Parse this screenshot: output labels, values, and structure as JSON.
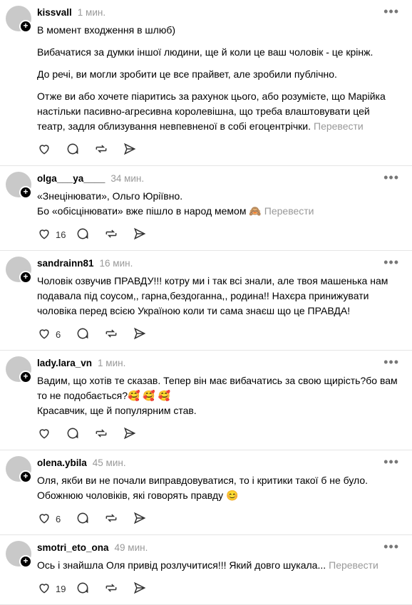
{
  "posts": [
    {
      "user": "kissvall",
      "time": "1 мин.",
      "paragraphs": [
        "В момент входження в шлюб)",
        "Вибачатися за думки іншої людини, ще й коли це ваш чоловік - це крінж.",
        "До речі, ви могли зробити це все прайвет, але зробили публічно.",
        "Отже ви або хочете піаритись за рахунок цього, або розумієте, що Марійка настільки пасивно-агресивна королевішна, що треба влаштовувати цей театр, задля облизування невпевненої в собі егоцентрічки."
      ],
      "translate": "Перевести",
      "likes": ""
    },
    {
      "user": "olga___ya____",
      "time": "34 мин.",
      "paragraphs": [
        "«Знецінювати», Ольго Юріївно.\nБо «обісцінювати» вже пішло в народ мемом 🙈"
      ],
      "translate": "Перевести",
      "likes": "16"
    },
    {
      "user": "sandrainn81",
      "time": "16 мин.",
      "paragraphs": [
        "Чоловік озвучив ПРАВДУ!!! котру ми і так всі знали, але твоя машенька нам подавала під соусом,, гарна,бездоганна,, родина!! Нахєра принижувати чоловіка перед всією Україною коли ти сама знаєш що це ПРАВДА!"
      ],
      "translate": "",
      "likes": "6"
    },
    {
      "user": "lady.lara_vn",
      "time": "1 мин.",
      "paragraphs": [
        "Вадим, що хотів те сказав. Тепер він має вибачатись за свою щирість?бо вам то не подобається?🥰 🥰 🥰\nКрасавчик, ще й популярним став."
      ],
      "translate": "",
      "likes": ""
    },
    {
      "user": "olena.ybila",
      "time": "45 мин.",
      "paragraphs": [
        "Оля, якби ви не почали виправдовуватися, то і критики такої б не було. Обожнюю чоловіків, які говорять правду 😊"
      ],
      "translate": "",
      "likes": "6"
    },
    {
      "user": "smotri_eto_ona",
      "time": "49 мин.",
      "paragraphs": [
        "Ось і знайшла Оля привід розлучитися!!! Який довго шукала..."
      ],
      "translate": "Перевести",
      "likes": "19"
    }
  ]
}
